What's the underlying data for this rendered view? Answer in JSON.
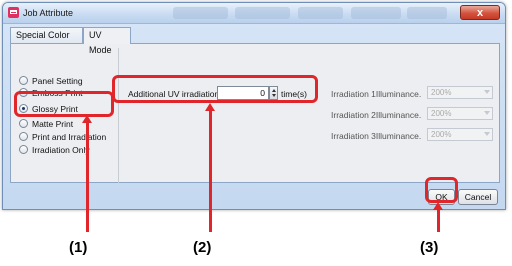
{
  "window": {
    "title": "Job Attribute",
    "close_symbol": "x"
  },
  "tabs": [
    {
      "label": "Special Color",
      "active": false
    },
    {
      "label": "UV Mode",
      "active": true
    }
  ],
  "modes": [
    {
      "label": "Panel Setting",
      "checked": false
    },
    {
      "label": "Emboss Print",
      "checked": false
    },
    {
      "label": "Glossy Print",
      "checked": true
    },
    {
      "label": "Matte Print",
      "checked": false
    },
    {
      "label": "Print and Irradiation",
      "checked": false
    },
    {
      "label": "Irradiation Only",
      "checked": false
    }
  ],
  "uv": {
    "label": "Additional UV irradiation",
    "value": "0",
    "unit": "time(s)"
  },
  "irradiation": [
    {
      "label": "Irradiation 1Illuminance.",
      "value": "200%"
    },
    {
      "label": "Irradiation 2Illuminance.",
      "value": "200%"
    },
    {
      "label": "Irradiation 3Illuminance.",
      "value": "200%"
    }
  ],
  "buttons": {
    "ok": "OK",
    "cancel": "Cancel"
  },
  "callouts": [
    "(1)",
    "(2)",
    "(3)"
  ],
  "colors": {
    "highlight": "#e0262a",
    "title_bar": "#c9dcf2",
    "panel": "#eceef1"
  }
}
